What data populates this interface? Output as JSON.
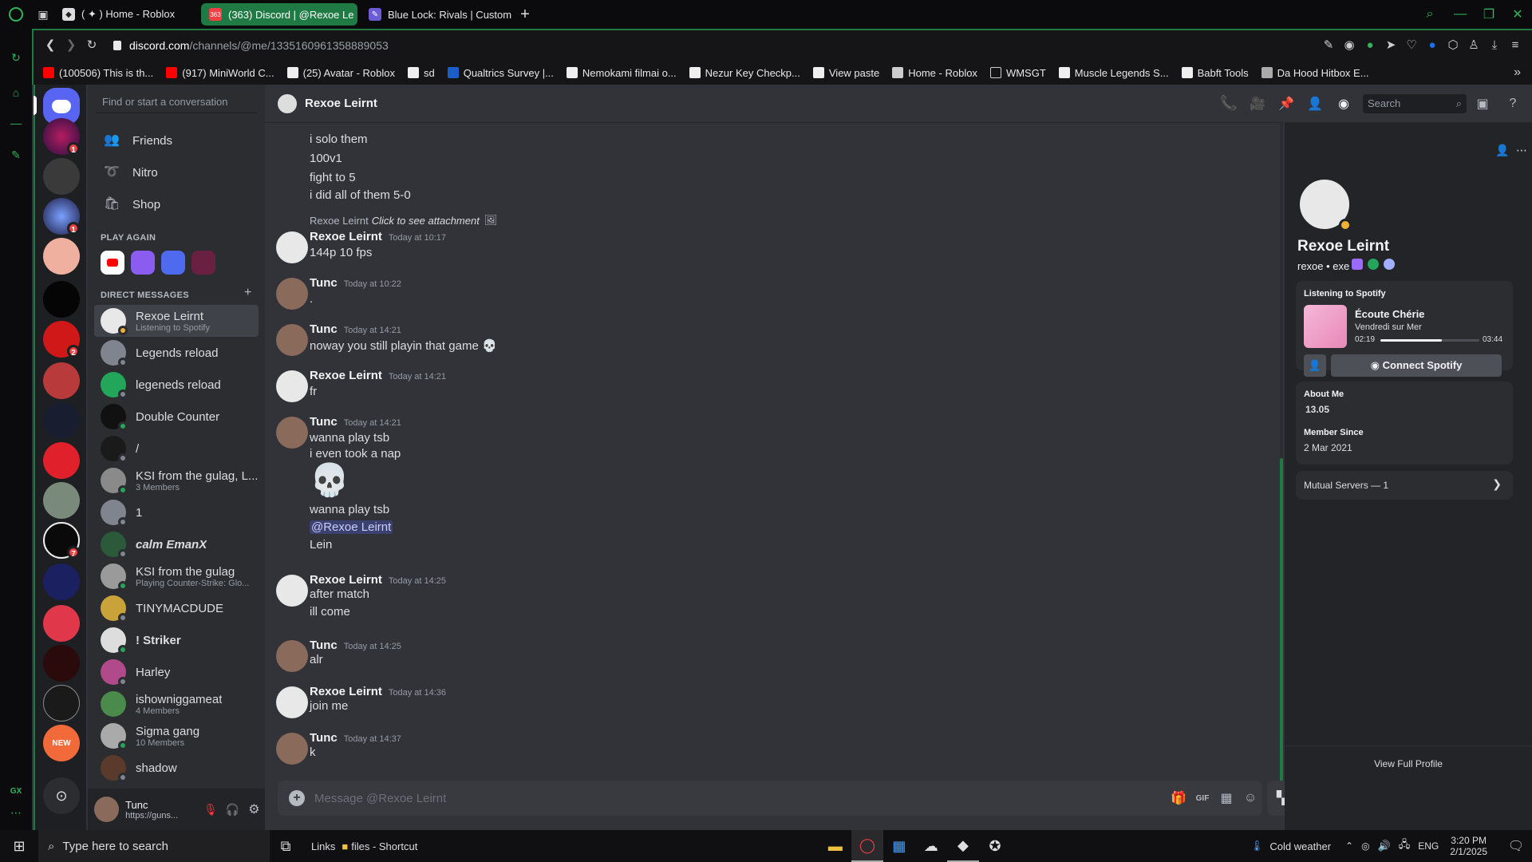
{
  "browser": {
    "tabs": [
      {
        "label": "( ✦ ) Home - Roblox",
        "active": false
      },
      {
        "label": "(363) Discord | @Rexoe Le",
        "active": true,
        "badge": "363"
      },
      {
        "label": "Blue Lock: Rivals | Custom",
        "active": false
      }
    ],
    "new_tab_glyph": "+",
    "url_host": "discord.com",
    "url_path": "/channels/@me/1335160961358889053",
    "bookmarks": [
      "(100506) This is th...",
      "(917) MiniWorld C...",
      "(25) Avatar - Roblox",
      "sd",
      "Qualtrics Survey |...",
      "Nemokami filmai o...",
      "Nezur Key Checkp...",
      "View paste",
      "Home - Roblox",
      "WMSGT",
      "Muscle Legends S...",
      "Babft Tools",
      "Da Hood Hitbox E..."
    ],
    "rail_label": "GX",
    "accent": "#1f7a44"
  },
  "sidebar": {
    "search_placeholder": "Find or start a conversation",
    "nav": [
      {
        "label": "Friends",
        "icon": "friends-icon"
      },
      {
        "label": "Nitro",
        "icon": "nitro-icon"
      },
      {
        "label": "Shop",
        "icon": "shop-icon"
      }
    ],
    "play_again": "PLAY AGAIN",
    "direct_messages": "DIRECT MESSAGES",
    "dms": [
      {
        "name": "Rexoe Leirnt",
        "sub": "Listening to Spotify",
        "status": "idle",
        "active": true
      },
      {
        "name": "Legends reload",
        "sub": "",
        "status": "offline"
      },
      {
        "name": "legeneds reload",
        "sub": "",
        "status": "offline"
      },
      {
        "name": "Double Counter",
        "sub": "",
        "status": "online"
      },
      {
        "name": "/",
        "sub": "",
        "status": "offline"
      },
      {
        "name": "KSI from the gulag, L...",
        "sub": "3 Members",
        "status": "group"
      },
      {
        "name": "1",
        "sub": "",
        "status": "offline"
      },
      {
        "name": "calm EmanX",
        "sub": "",
        "status": "offline"
      },
      {
        "name": "KSI from the gulag",
        "sub": "Playing Counter-Strike: Glo...",
        "status": "online"
      },
      {
        "name": "TINYMACDUDE",
        "sub": "",
        "status": "offline"
      },
      {
        "name": "! Striker",
        "sub": "",
        "status": "online"
      },
      {
        "name": "Harley",
        "sub": "",
        "status": "offline"
      },
      {
        "name": "ishowniggameat",
        "sub": "4 Members",
        "status": "group"
      },
      {
        "name": "Sigma gang",
        "sub": "10 Members",
        "status": "group"
      },
      {
        "name": "shadow",
        "sub": "",
        "status": "offline"
      }
    ],
    "user": {
      "name": "Tunc",
      "status": "https://guns..."
    }
  },
  "guild_badges": [
    "1",
    "1",
    "2",
    "7"
  ],
  "guild_new_label": "NEW",
  "chat": {
    "header_name": "Rexoe Leirnt",
    "search_placeholder": "Search",
    "early_lines": [
      "i solo them",
      "100v1",
      "fight to 5",
      "i did all of them 5-0"
    ],
    "reply_author": "Rexoe Leirnt",
    "reply_text": "Click to see attachment",
    "messages": [
      {
        "author": "Rexoe Leirnt",
        "time": "Today at 10:17",
        "lines": [
          "144p 10 fps"
        ]
      },
      {
        "author": "Tunc",
        "time": "Today at 10:22",
        "lines": [
          "."
        ]
      },
      {
        "author": "Tunc",
        "time": "Today at 14:21",
        "lines": [
          "noway you still playin that game 💀"
        ]
      },
      {
        "author": "Rexoe Leirnt",
        "time": "Today at 14:21",
        "lines": [
          "fr"
        ]
      },
      {
        "author": "Tunc",
        "time": "Today at 14:21",
        "lines": [
          "wanna play tsb",
          "i even took a nap",
          "💀",
          "wanna play tsb",
          "@Rexoe Leirnt",
          "Lein"
        ]
      },
      {
        "author": "Rexoe Leirnt",
        "time": "Today at 14:25",
        "lines": [
          "after match",
          "ill come"
        ]
      },
      {
        "author": "Tunc",
        "time": "Today at 14:25",
        "lines": [
          "alr"
        ]
      },
      {
        "author": "Rexoe Leirnt",
        "time": "Today at 14:36",
        "lines": [
          "join me"
        ]
      },
      {
        "author": "Tunc",
        "time": "Today at 14:37",
        "lines": [
          "k"
        ]
      }
    ],
    "composer_placeholder": "Message @Rexoe Leirnt",
    "gif_label": "GIF"
  },
  "profile": {
    "display_name": "Rexoe Leirnt",
    "username": "rexoe • exe",
    "listening_title": "Listening to Spotify",
    "song_title": "Écoute Chérie",
    "song_artist": "Vendredi sur Mer",
    "elapsed": "02:19",
    "duration": "03:44",
    "progress": 0.62,
    "connect_label": "Connect Spotify",
    "about_title": "About Me",
    "about_text": "13.05",
    "member_since_title": "Member Since",
    "member_since": "2 Mar 2021",
    "mutual_servers": "Mutual Servers — 1",
    "view_full": "View Full Profile"
  },
  "taskbar": {
    "search_placeholder": "Type here to search",
    "links_label": "Links",
    "shortcut_label": "files - Shortcut",
    "weather": "Cold weather",
    "lang": "ENG",
    "time": "3:20 PM",
    "date": "2/1/2025"
  }
}
